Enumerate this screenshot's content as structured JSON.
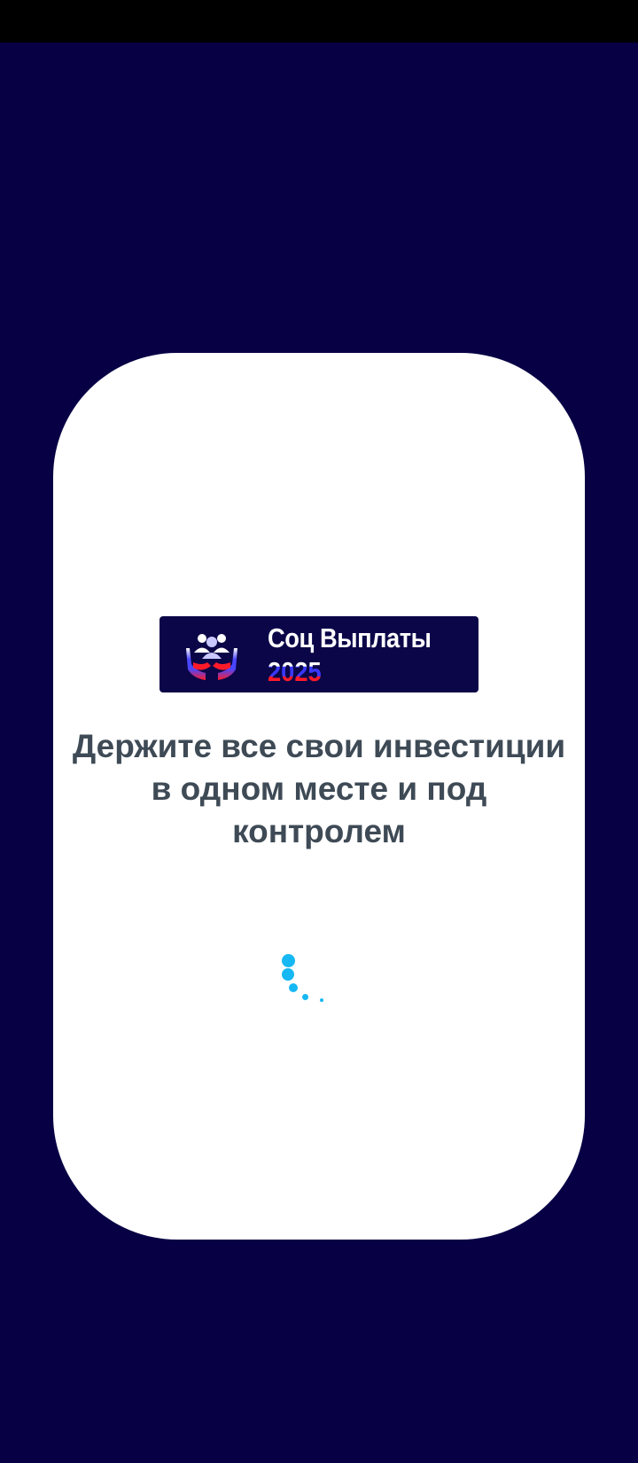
{
  "app": {
    "logo": {
      "title": "Соц Выплаты",
      "year": "2025",
      "emblem_icon": "people-in-hands-icon"
    },
    "tagline": "Держите все свои инвестиции в одном месте и под контролем",
    "loader_icon": "loading-spinner-icon"
  },
  "colors": {
    "background": "#070045",
    "status_bar": "#000000",
    "card": "#ffffff",
    "tagline": "#3e4a55",
    "spinner": "#16b8f3",
    "logo_blue": "#3a38ff",
    "logo_red": "#ff1a2a"
  }
}
